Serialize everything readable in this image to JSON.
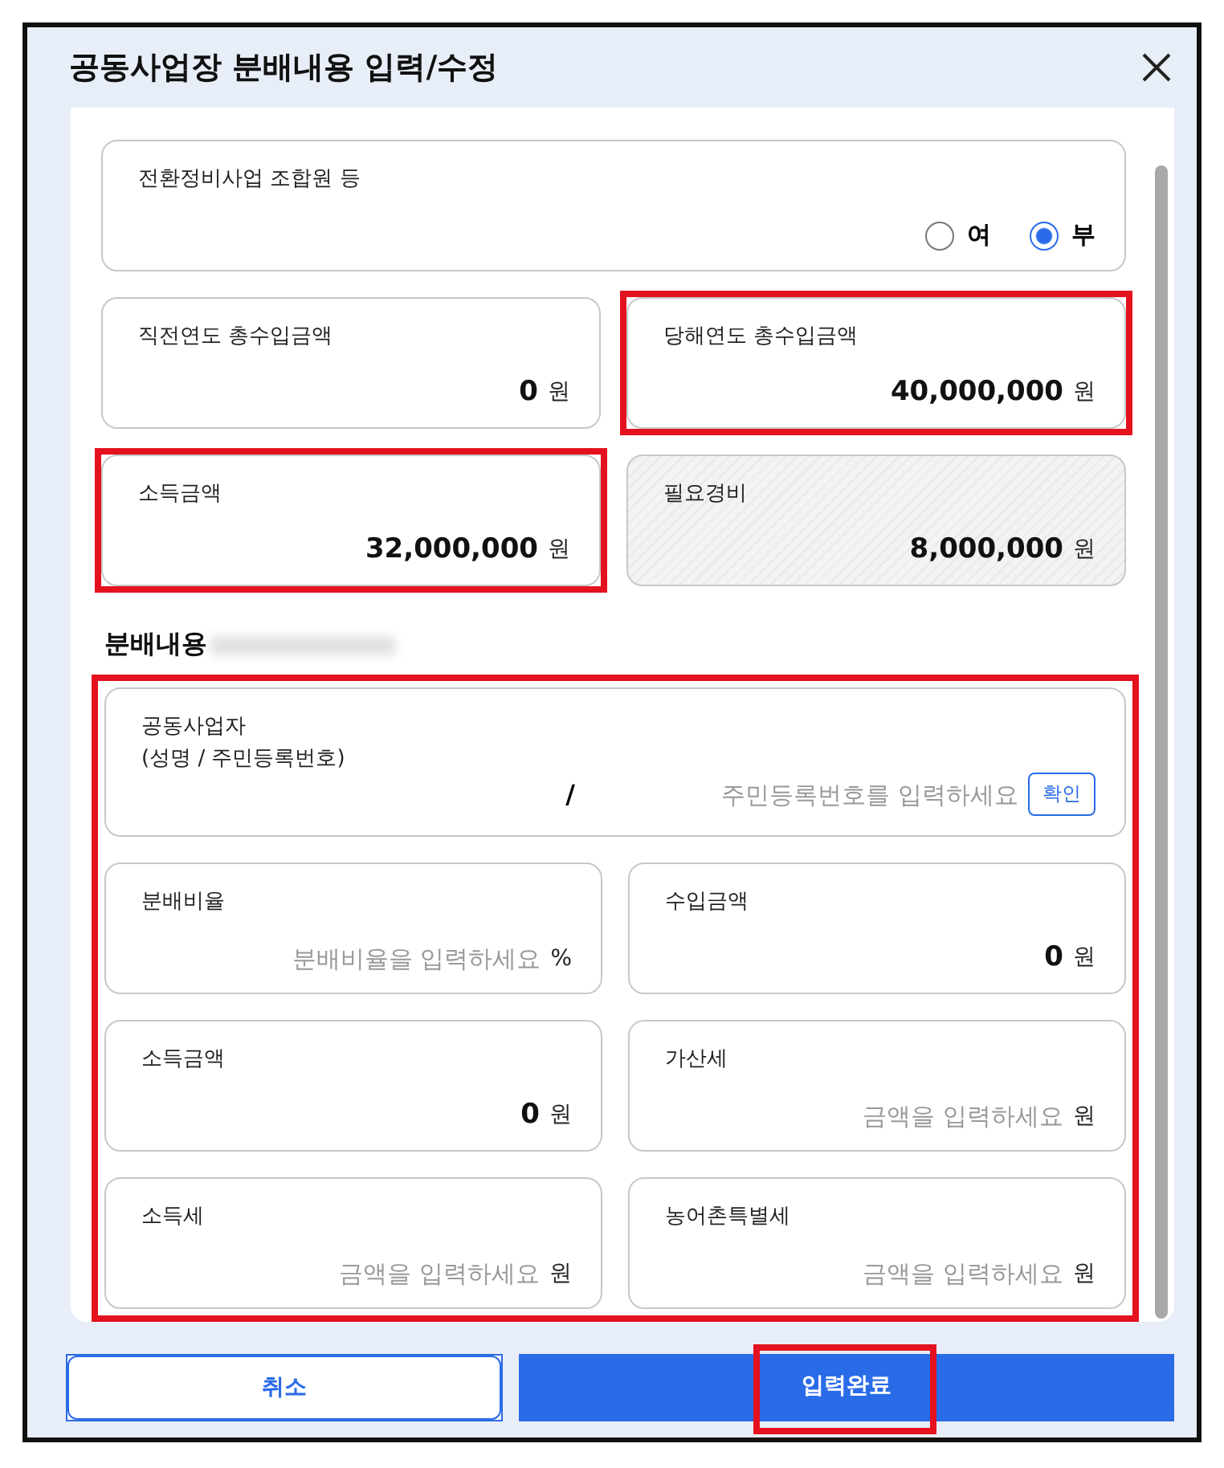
{
  "dialog": {
    "title": "공동사업장 분배내용 입력/수정"
  },
  "top_fields": [
    {
      "kind": "radio",
      "label": "전환정비사업 조합원 등",
      "options": [
        {
          "label": "여",
          "selected": false
        },
        {
          "label": "부",
          "selected": true
        }
      ],
      "highlighted": false
    },
    {
      "kind": "value",
      "label": "직전연도 총수입금액",
      "value": "0",
      "unit": "원",
      "highlighted": false
    },
    {
      "kind": "value",
      "label": "당해연도 총수입금액",
      "value": "40,000,000",
      "unit": "원",
      "highlighted": true
    },
    {
      "kind": "value",
      "label": "소득금액",
      "value": "32,000,000",
      "unit": "원",
      "highlighted": true
    },
    {
      "kind": "readonly",
      "label": "필요경비",
      "value": "8,000,000",
      "unit": "원",
      "highlighted": false
    }
  ],
  "section": {
    "title": "분배내용",
    "highlighted": true
  },
  "distribution_fields": [
    {
      "kind": "resident",
      "label": "공동사업자",
      "sublabel": "(성명 / 주민등록번호)",
      "separator": "/",
      "placeholder": "주민등록번호를 입력하세요",
      "button": "확인"
    },
    {
      "kind": "input",
      "label": "분배비율",
      "placeholder": "분배비율을 입력하세요",
      "unit": "%"
    },
    {
      "kind": "value",
      "label": "수입금액",
      "value": "0",
      "unit": "원"
    },
    {
      "kind": "value",
      "label": "소득금액",
      "value": "0",
      "unit": "원"
    },
    {
      "kind": "input",
      "label": "가산세",
      "placeholder": "금액을 입력하세요",
      "unit": "원"
    },
    {
      "kind": "input",
      "label": "소득세",
      "placeholder": "금액을 입력하세요",
      "unit": "원"
    },
    {
      "kind": "input",
      "label": "농어촌특별세",
      "placeholder": "금액을 입력하세요",
      "unit": "원"
    }
  ],
  "buttons": [
    {
      "label": "취소",
      "kind": "secondary",
      "highlighted": false
    },
    {
      "label": "입력완료",
      "kind": "primary",
      "highlighted": true
    }
  ]
}
